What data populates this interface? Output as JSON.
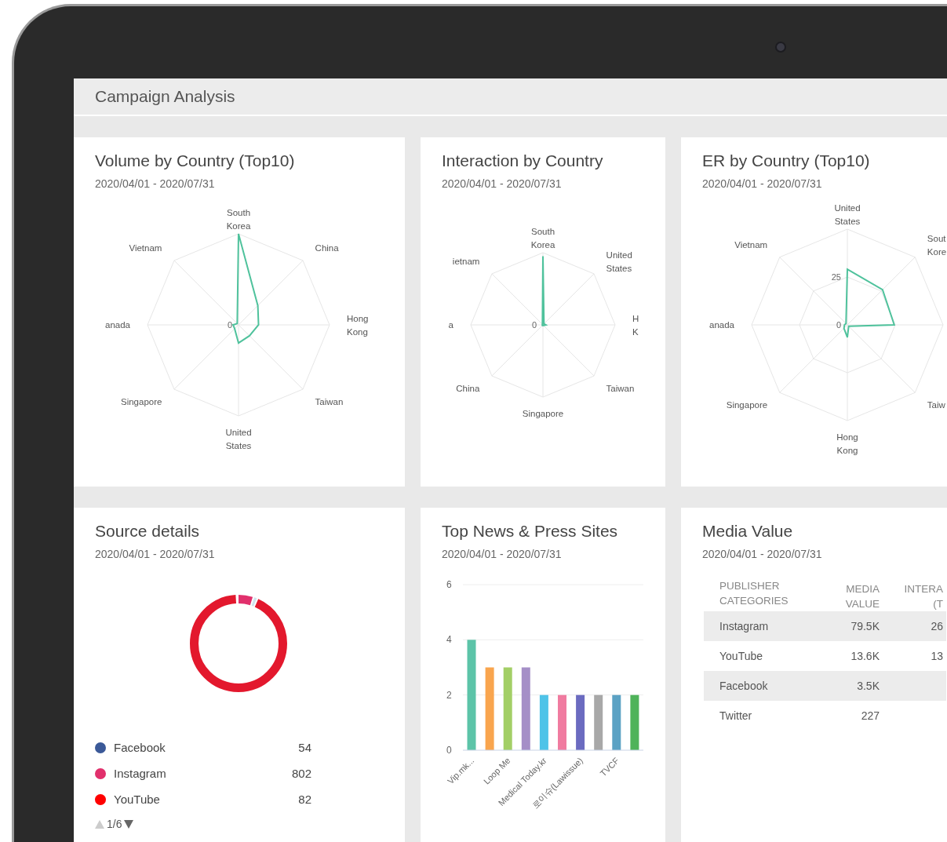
{
  "window": {
    "title": "Campaign Analysis"
  },
  "cards": [
    {
      "kind": "radar",
      "title": "Volume by Country (Top10)",
      "date_range": "2020/04/01 - 2020/07/31",
      "ticks": [
        "0"
      ],
      "axes": [
        {
          "kind": "labeled",
          "label": "South\nKorea"
        },
        {
          "kind": "labeled",
          "label": "China"
        },
        {
          "kind": "labeled",
          "label": "Hong\nKong"
        },
        {
          "kind": "labeled",
          "label": "Taiwan"
        },
        {
          "kind": "labeled",
          "label": "United\nStates"
        },
        {
          "kind": "labeled",
          "label": "Singapore"
        },
        {
          "kind": "labeled",
          "label": "anada"
        },
        {
          "kind": "labeled",
          "label": "Vietnam"
        }
      ]
    },
    {
      "kind": "radar",
      "title": "Interaction by Country",
      "date_range": "2020/04/01 - 2020/07/31",
      "ticks": [
        "0"
      ],
      "axes": [
        {
          "kind": "labeled",
          "label": "South\nKorea"
        },
        {
          "kind": "labeled",
          "label": "United\nStates"
        },
        {
          "kind": "labeled",
          "label": "H\nK"
        },
        {
          "kind": "labeled",
          "label": "Taiwan"
        },
        {
          "kind": "labeled",
          "label": "Singapore"
        },
        {
          "kind": "labeled",
          "label": "China"
        },
        {
          "kind": "labeled",
          "label": "a"
        },
        {
          "kind": "labeled",
          "label": "ietnam"
        }
      ]
    },
    {
      "kind": "radar",
      "title": "ER by Country (Top10)",
      "date_range": "2020/04/01 - 2020/07/31",
      "ticks": [
        "25",
        "0"
      ],
      "axes": [
        {
          "kind": "labeled",
          "label": "United\nStates"
        },
        {
          "kind": "labeled",
          "label": "Sout\nKore"
        },
        {
          "kind": "unlabeled"
        },
        {
          "kind": "labeled",
          "label": "Taiw"
        },
        {
          "kind": "labeled",
          "label": "Hong\nKong"
        },
        {
          "kind": "labeled",
          "label": "Singapore"
        },
        {
          "kind": "labeled",
          "label": "anada"
        },
        {
          "kind": "labeled",
          "label": "Vietnam"
        }
      ]
    },
    {
      "kind": "donut",
      "title": "Source details",
      "date_range": "2020/04/01 - 2020/07/31",
      "legend": [
        {
          "label": "Facebook",
          "value": "54",
          "color": "#3b5998"
        },
        {
          "label": "Instagram",
          "value": "802",
          "color": "#e1306c"
        },
        {
          "label": "YouTube",
          "value": "82",
          "color": "#ff0000"
        }
      ],
      "pager": "1/6"
    },
    {
      "kind": "bar",
      "title": "Top News & Press Sites",
      "date_range": "2020/04/01 - 2020/07/31",
      "chart_data": {
        "type": "bar",
        "categories": [
          "Vip.mk...",
          null,
          "Loop Me",
          null,
          "Medical Today.kr",
          null,
          "로이슈(Lawissue)",
          null,
          "TVCF",
          null
        ],
        "values": [
          4,
          3,
          3,
          3,
          2,
          2,
          2,
          2,
          2,
          2
        ],
        "colors": [
          "#5cc4a8",
          "#f9a54e",
          "#a3cf66",
          "#a58fc7",
          "#4fc3e8",
          "#f07ba0",
          "#6b6bc0",
          "#a8a8a8",
          "#5ba2c4",
          "#4fb35a"
        ],
        "ylim": [
          0,
          6
        ],
        "yticks": [
          0,
          2,
          4,
          6
        ]
      }
    },
    {
      "kind": "table",
      "title": "Media Value",
      "date_range": "2020/04/01 - 2020/07/31",
      "columns": [
        "PUBLISHER\nCATEGORIES",
        "MEDIA\nVALUE",
        "INTERA\n(T"
      ],
      "rows": [
        [
          "Instagram",
          "79.5K",
          "26"
        ],
        [
          "YouTube",
          "13.6K",
          "13"
        ],
        [
          "Facebook",
          "3.5K"
        ],
        [
          "Twitter",
          "227"
        ]
      ]
    }
  ]
}
